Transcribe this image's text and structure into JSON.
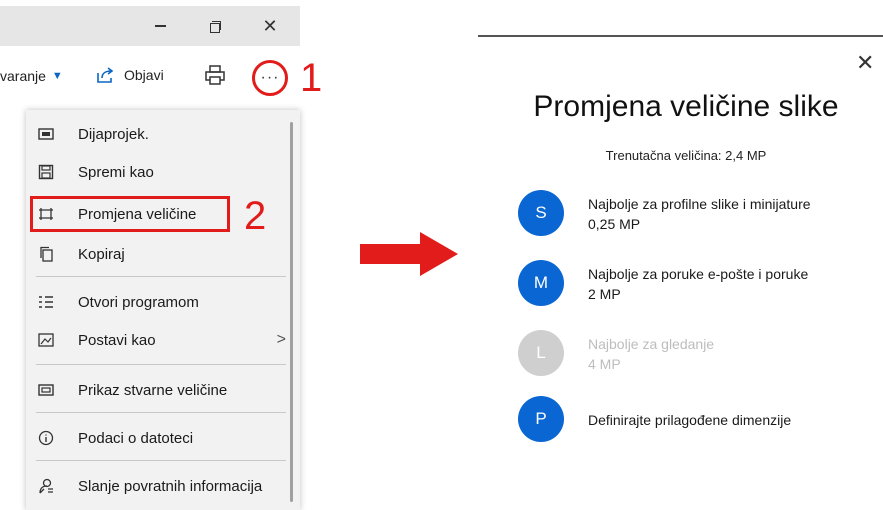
{
  "window_controls": {
    "minimize": "—",
    "maximize": "❐",
    "close": "✕"
  },
  "toolbar": {
    "edit_label": "varanje",
    "share_label": "Objavi",
    "more_label": "···"
  },
  "steps": {
    "one": "1",
    "two": "2"
  },
  "menu": {
    "items": [
      {
        "label": "Dijaprojek.",
        "icon": "slideshow-icon"
      },
      {
        "label": "Spremi kao",
        "icon": "save-icon"
      },
      {
        "label": "Promjena veličine",
        "icon": "resize-icon"
      },
      {
        "label": "Kopiraj",
        "icon": "copy-icon"
      },
      {
        "label": "Otvori programom",
        "icon": "open-with-icon"
      },
      {
        "label": "Postavi kao",
        "icon": "set-as-icon",
        "arrow": ">"
      },
      {
        "label": "Prikaz stvarne veličine",
        "icon": "actual-size-icon"
      },
      {
        "label": "Podaci o datoteci",
        "icon": "info-icon"
      },
      {
        "label": "Slanje povratnih informacija",
        "icon": "feedback-icon"
      }
    ]
  },
  "dialog": {
    "close": "✕",
    "title": "Promjena veličine slike",
    "current_size": "Trenutačna veličina: 2,4 MP",
    "options": [
      {
        "letter": "S",
        "line1": "Najbolje za profilne slike i minijature",
        "line2": "0,25 MP",
        "enabled": true
      },
      {
        "letter": "M",
        "line1": "Najbolje za poruke e-pošte i poruke",
        "line2": "2 MP",
        "enabled": true
      },
      {
        "letter": "L",
        "line1": "Najbolje za gledanje",
        "line2": "4 MP",
        "enabled": false
      },
      {
        "letter": "P",
        "line1": "Definirajte prilagođene dimenzije",
        "line2": "",
        "enabled": true
      }
    ]
  },
  "colors": {
    "accent": "#0a66d2",
    "highlight": "#e21b1b",
    "disabled": "#cfcfcf"
  }
}
